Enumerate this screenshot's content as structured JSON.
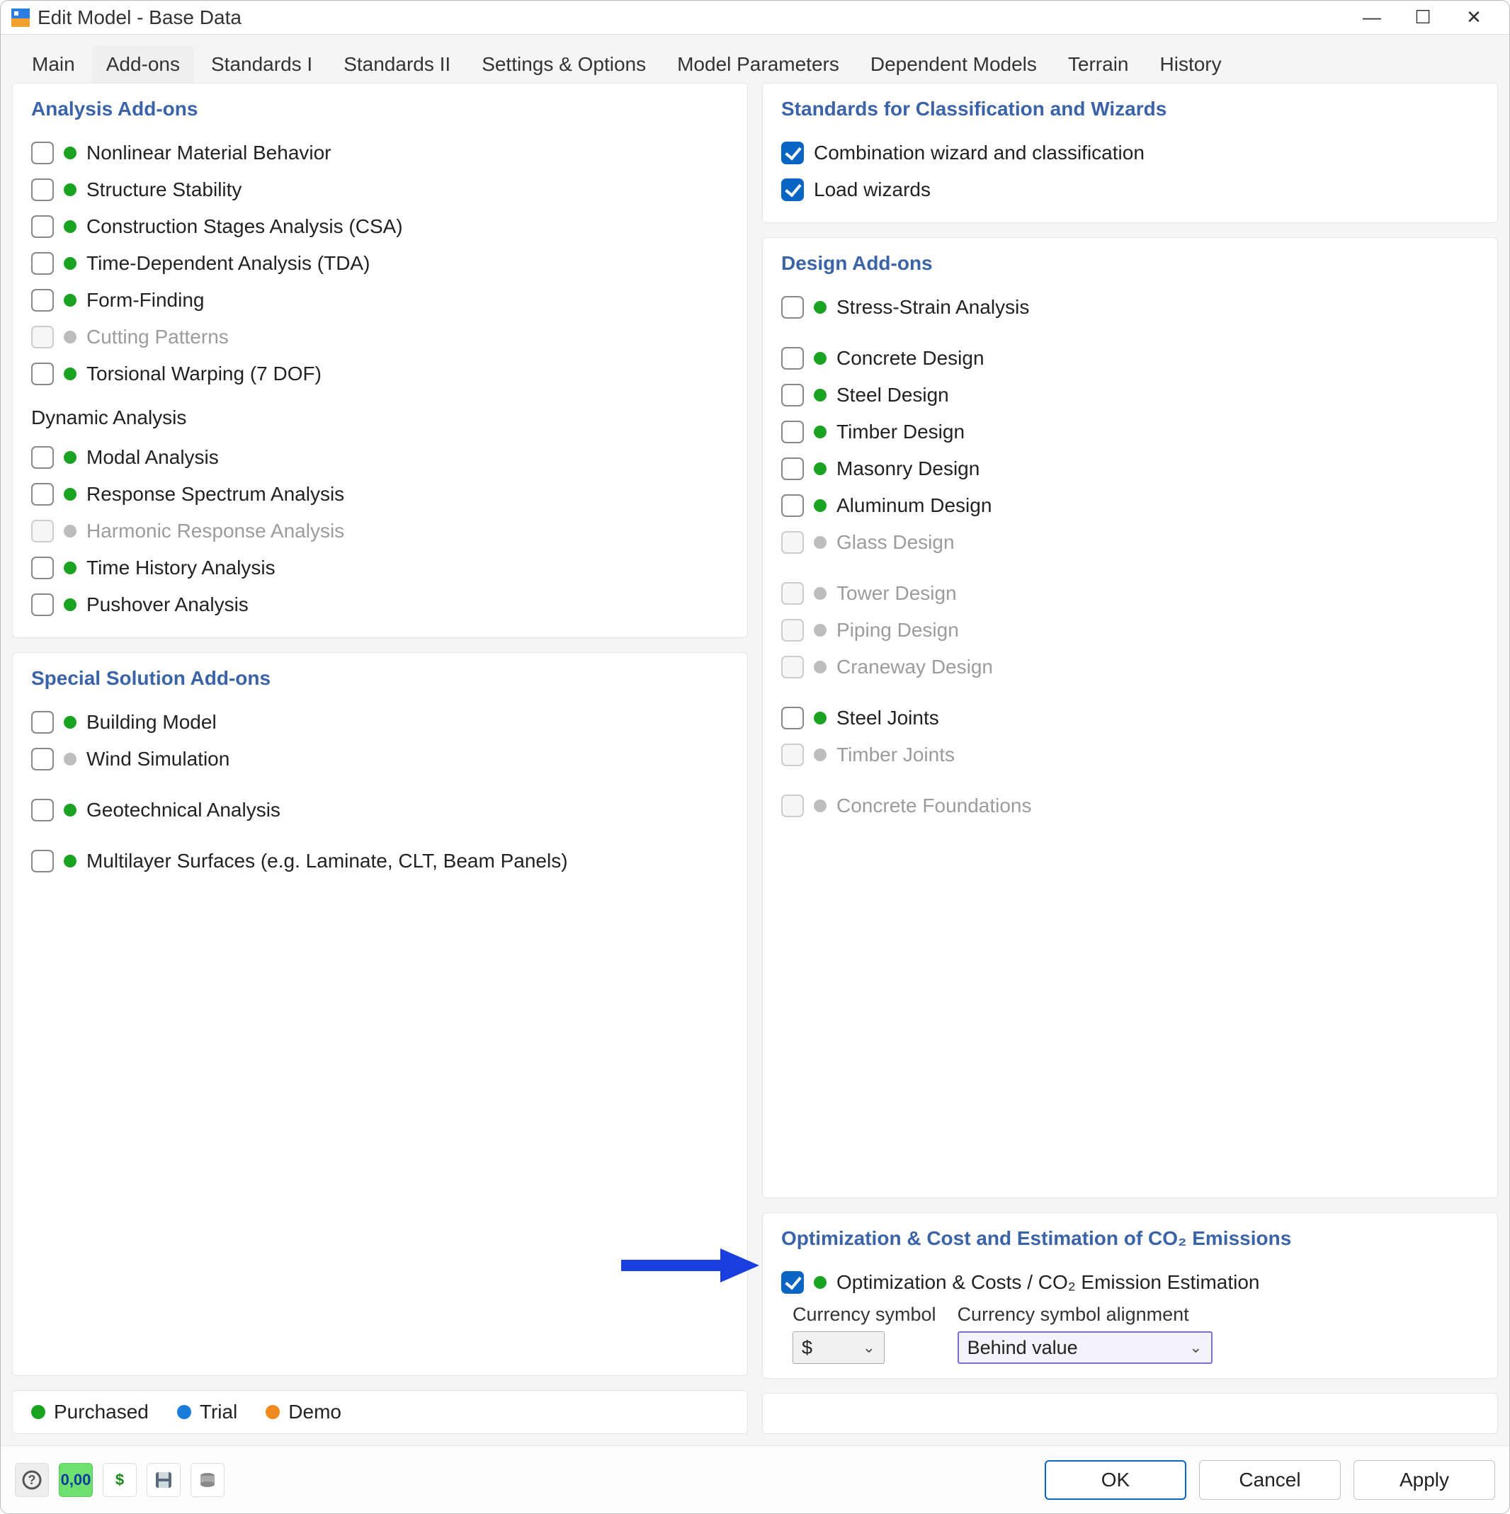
{
  "window": {
    "title": "Edit Model - Base Data"
  },
  "tabs": [
    "Main",
    "Add-ons",
    "Standards I",
    "Standards II",
    "Settings & Options",
    "Model Parameters",
    "Dependent Models",
    "Terrain",
    "History"
  ],
  "activeTab": "Add-ons",
  "left": {
    "analysis": {
      "title": "Analysis Add-ons",
      "items": [
        {
          "label": "Nonlinear Material Behavior",
          "status": "green",
          "enabled": true
        },
        {
          "label": "Structure Stability",
          "status": "green",
          "enabled": true
        },
        {
          "label": "Construction Stages Analysis (CSA)",
          "status": "green",
          "enabled": true
        },
        {
          "label": "Time-Dependent Analysis (TDA)",
          "status": "green",
          "enabled": true
        },
        {
          "label": "Form-Finding",
          "status": "green",
          "enabled": true
        },
        {
          "label": "Cutting Patterns",
          "status": "grey",
          "enabled": false
        },
        {
          "label": "Torsional Warping (7 DOF)",
          "status": "green",
          "enabled": true
        }
      ],
      "dynamic_header": "Dynamic Analysis",
      "dynamic_items": [
        {
          "label": "Modal Analysis",
          "status": "green",
          "enabled": true
        },
        {
          "label": "Response Spectrum Analysis",
          "status": "green",
          "enabled": true
        },
        {
          "label": "Harmonic Response Analysis",
          "status": "grey",
          "enabled": false
        },
        {
          "label": "Time History Analysis",
          "status": "green",
          "enabled": true
        },
        {
          "label": "Pushover Analysis",
          "status": "green",
          "enabled": true
        }
      ]
    },
    "special": {
      "title": "Special Solution Add-ons",
      "items": [
        {
          "label": "Building Model",
          "status": "green",
          "enabled": true
        },
        {
          "label": "Wind Simulation",
          "status": "grey",
          "enabled": true
        },
        {
          "label": "Geotechnical Analysis",
          "status": "green",
          "enabled": true
        },
        {
          "label": "Multilayer Surfaces (e.g. Laminate, CLT, Beam Panels)",
          "status": "green",
          "enabled": true
        }
      ]
    }
  },
  "right": {
    "standards": {
      "title": "Standards for Classification and Wizards",
      "items": [
        {
          "label": "Combination wizard and classification",
          "checked": true
        },
        {
          "label": "Load wizards",
          "checked": true
        }
      ]
    },
    "design": {
      "title": "Design Add-ons",
      "group1": [
        {
          "label": "Stress-Strain Analysis",
          "status": "green",
          "enabled": true
        }
      ],
      "group2": [
        {
          "label": "Concrete Design",
          "status": "green",
          "enabled": true
        },
        {
          "label": "Steel Design",
          "status": "green",
          "enabled": true
        },
        {
          "label": "Timber Design",
          "status": "green",
          "enabled": true
        },
        {
          "label": "Masonry Design",
          "status": "green",
          "enabled": true
        },
        {
          "label": "Aluminum Design",
          "status": "green",
          "enabled": true
        },
        {
          "label": "Glass Design",
          "status": "grey",
          "enabled": false
        }
      ],
      "group3": [
        {
          "label": "Tower Design",
          "status": "grey",
          "enabled": false
        },
        {
          "label": "Piping Design",
          "status": "grey",
          "enabled": false
        },
        {
          "label": "Craneway Design",
          "status": "grey",
          "enabled": false
        }
      ],
      "group4": [
        {
          "label": "Steel Joints",
          "status": "green",
          "enabled": true
        },
        {
          "label": "Timber Joints",
          "status": "grey",
          "enabled": false
        }
      ],
      "group5": [
        {
          "label": "Concrete Foundations",
          "status": "grey",
          "enabled": false
        }
      ]
    },
    "optimization": {
      "title": "Optimization & Cost and Estimation of CO₂ Emissions",
      "item": {
        "label": "Optimization & Costs / CO₂ Emission Estimation",
        "status": "green",
        "checked": true
      },
      "currency_label": "Currency symbol",
      "alignment_label": "Currency symbol alignment",
      "currency_value": "$",
      "alignment_value": "Behind value"
    }
  },
  "legend": {
    "purchased": "Purchased",
    "trial": "Trial",
    "demo": "Demo"
  },
  "buttons": {
    "ok": "OK",
    "cancel": "Cancel",
    "apply": "Apply"
  }
}
